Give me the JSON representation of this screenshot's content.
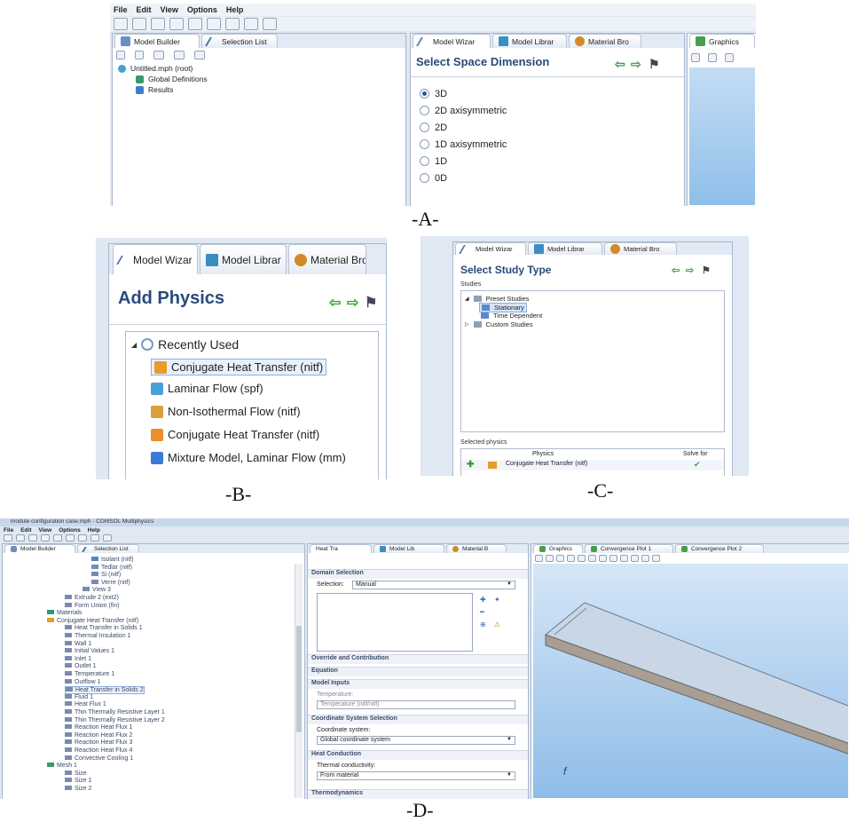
{
  "captions": {
    "a": "-A-",
    "b": "-B-",
    "c": "-C-",
    "d": "-D-"
  },
  "panelA": {
    "menu": [
      "File",
      "Edit",
      "View",
      "Options",
      "Help"
    ],
    "tabs_left": [
      "Model Builder",
      "Selection List"
    ],
    "tabs_right": [
      "Model Wizar",
      "Model Librar",
      "Material Bro"
    ],
    "tab_graphics": "Graphics",
    "tree": [
      "Untitled.mph (root)",
      "Global Definitions",
      "Results"
    ],
    "heading": "Select Space Dimension",
    "options": [
      "3D",
      "2D axisymmetric",
      "2D",
      "1D axisymmetric",
      "1D",
      "0D"
    ],
    "selected_index": 0
  },
  "panelB": {
    "tabs": [
      "Model Wizar",
      "Model Librar",
      "Material Bro"
    ],
    "heading": "Add Physics",
    "group": "Recently Used",
    "items": [
      {
        "label": "Conjugate Heat Transfer (nitf)",
        "color": "#e89a2a"
      },
      {
        "label": "Laminar Flow (spf)",
        "color": "#4aa0d8"
      },
      {
        "label": "Non-Isothermal Flow (nitf)",
        "color": "#d8a03a"
      },
      {
        "label": "Conjugate Heat Transfer (nitf)",
        "color": "#e8902a"
      },
      {
        "label": "Mixture Model, Laminar Flow (mm)",
        "color": "#3a7ad8"
      }
    ]
  },
  "panelC": {
    "tabs": [
      "Model Wizar",
      "Model Librar",
      "Material Bro"
    ],
    "heading": "Select Study Type",
    "studies_label": "Studies",
    "tree": [
      "Preset Studies",
      "Stationary",
      "Time Dependent",
      "Custom Studies"
    ],
    "selected_physics_label": "Selected physics",
    "col_physics": "Physics",
    "col_solve": "Solve for",
    "row_physics": "Conjugate Heat Transfer (nitf)",
    "solve_check": "✔"
  },
  "panelD": {
    "title": "module configuration case.mph - COMSOL Multiphysics",
    "menu": [
      "File",
      "Edit",
      "View",
      "Options",
      "Help"
    ],
    "tabs_left": [
      "Model Builder",
      "Selection List"
    ],
    "tabs_mid": [
      "Heat Tra",
      "Model Lib",
      "Material B"
    ],
    "tabs_right": [
      "Graphics",
      "Convergence Plot 1",
      "Convergence Plot 2"
    ],
    "tree": [
      "Isolant (nitf)",
      "Tedlar (nitf)",
      "Si (nitf)",
      "Verre (nitf)",
      "View 3",
      "Extrude 2 (ext2)",
      "Form Union (fin)",
      "Materials",
      "Conjugate Heat Transfer (nitf)",
      "Heat Transfer in Solids 1",
      "Thermal Insulation 1",
      "Wall 1",
      "Initial Values 1",
      "Inlet 1",
      "Outlet 1",
      "Temperature 1",
      "Outflow 1",
      "Heat Transfer in Solids 2",
      "Fluid 1",
      "Heat Flux 1",
      "Thin Thermally Resistive Layer 1",
      "Thin Thermally Resistive Layer 2",
      "Reaction Heat Flux 1",
      "Reaction Heat Flux 2",
      "Reaction Heat Flux 3",
      "Reaction Heat Flux 4",
      "Convective Cooling 1",
      "Mesh 1",
      "Size",
      "Size 1",
      "Size 2"
    ],
    "settings": {
      "domain_selection": "Domain Selection",
      "selection_label": "Selection:",
      "selection_value": "Manual",
      "override": "Override and Contribution",
      "equation": "Equation",
      "model_inputs": "Model Inputs",
      "temperature": "Temperature:",
      "temperature_value": "Temperature (nitf/nitf)",
      "coord": "Coordinate System Selection",
      "coord_label": "Coordinate system:",
      "coord_value": "Global coordinate system",
      "heat_conduction": "Heat Conduction",
      "thermal_cond": "Thermal conductivity:",
      "thermal_value": "From material",
      "thermodynamics": "Thermodynamics"
    }
  }
}
